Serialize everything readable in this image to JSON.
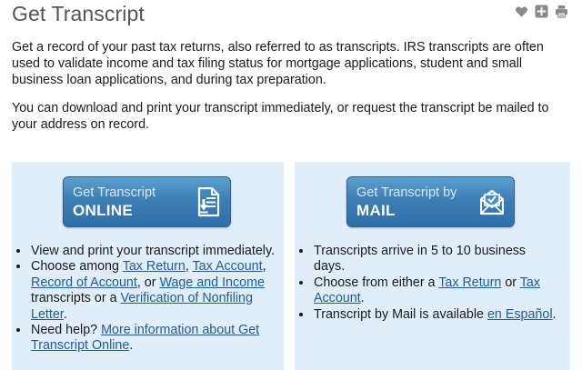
{
  "header": {
    "title": "Get Transcript",
    "tools": [
      "heart-icon",
      "plus-icon",
      "print-icon"
    ]
  },
  "intro": {
    "p1": "Get a record of your past tax returns, also referred to as transcripts. IRS transcripts are often used to validate income and tax filing status for mortgage applications, student and small business loan applications, and during tax preparation.",
    "p2": "You can download and print your transcript immediately, or request the transcript be mailed to your address on record."
  },
  "online": {
    "button_line1": "Get Transcript",
    "button_line2": "ONLINE",
    "icon": "download-document-icon",
    "b1": "View and print your transcript immediately.",
    "b2_pre": "Choose among ",
    "b2_link1": "Tax Return",
    "b2_sep1": ", ",
    "b2_link2": "Tax Account",
    "b2_sep2": ", ",
    "b2_link3": "Record of Account",
    "b2_sep3": ", or ",
    "b2_link4": "Wage and Income",
    "b2_mid": " transcripts or a ",
    "b2_link5": "Verification of Nonfiling Letter",
    "b2_end": ".",
    "b3_pre": "Need help? ",
    "b3_link": "More information about Get Transcript Online",
    "b3_end": "."
  },
  "mail": {
    "button_line1": "Get Transcript by",
    "button_line2": "MAIL",
    "icon": "envelope-icon",
    "b1": "Transcripts arrive in 5 to 10 business days.",
    "b2_pre": "Choose from either a ",
    "b2_link1": "Tax Return",
    "b2_mid": " or ",
    "b2_link2": "Tax Account",
    "b2_end": ".",
    "b3_pre": "Transcript by Mail is available ",
    "b3_link": "en Español",
    "b3_end": "."
  },
  "colors": {
    "panel_bg": "#e1eefa",
    "button_blue": "#3e7fb6",
    "link": "#1f5b9a",
    "title": "#555555"
  }
}
